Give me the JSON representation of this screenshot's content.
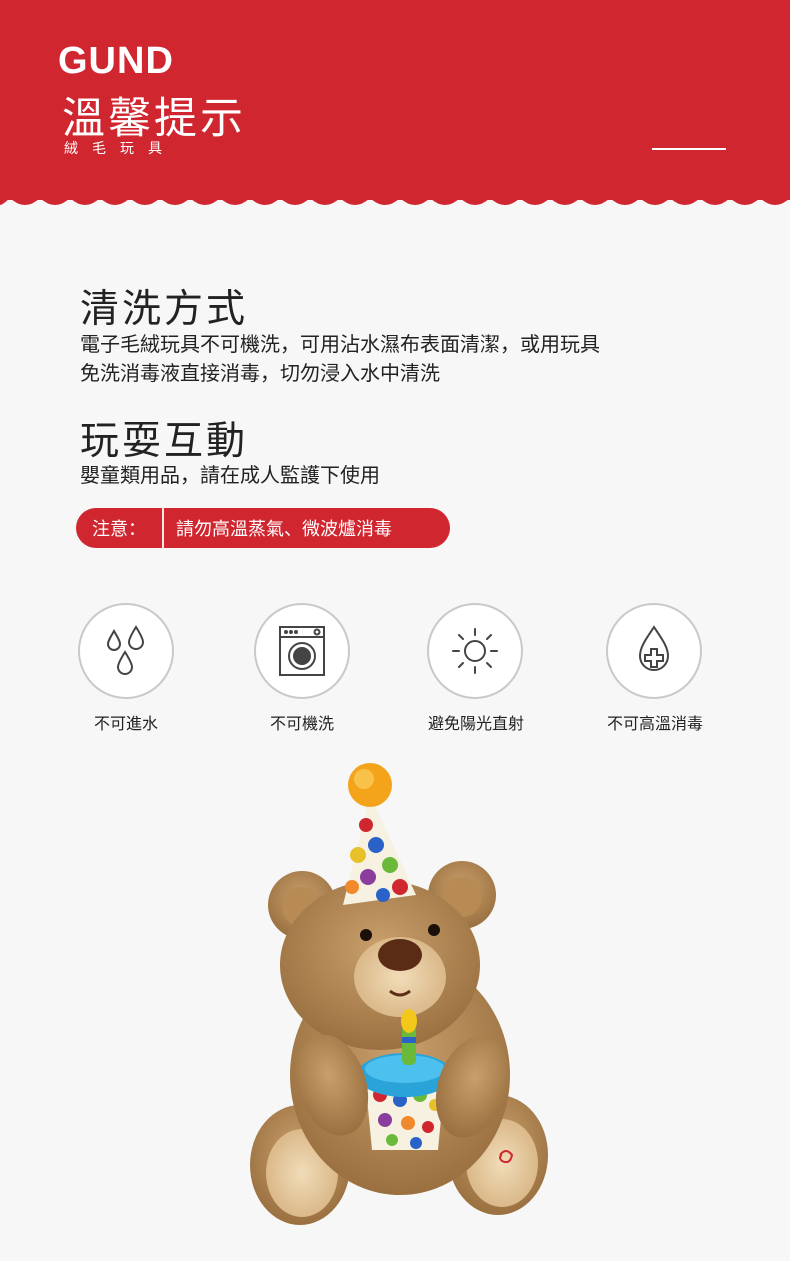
{
  "header": {
    "brand": "GUND",
    "title": "溫馨提示",
    "subtitle": "絨毛玩具"
  },
  "sections": [
    {
      "title": "清洗方式",
      "lines": [
        "電子毛絨玩具不可機洗，可用沾水濕布表面清潔，或用玩具",
        "免洗消毒液直接消毒，切勿浸入水中清洗"
      ]
    },
    {
      "title": "玩耍互動",
      "lines": [
        "嬰童類用品，請在成人監護下使用"
      ]
    }
  ],
  "notice": {
    "label": "注意：",
    "text": "請勿高溫蒸氣、微波爐消毒"
  },
  "care_icons": [
    {
      "label": "不可進水",
      "icon": "water-drops-icon"
    },
    {
      "label": "不可機洗",
      "icon": "washing-machine-icon"
    },
    {
      "label": "避免陽光直射",
      "icon": "sun-icon"
    },
    {
      "label": "不可高溫消毒",
      "icon": "drop-cross-icon"
    }
  ],
  "colors": {
    "accent": "#d0262f",
    "background": "#f7f7f7",
    "icon_stroke": "#444444"
  }
}
